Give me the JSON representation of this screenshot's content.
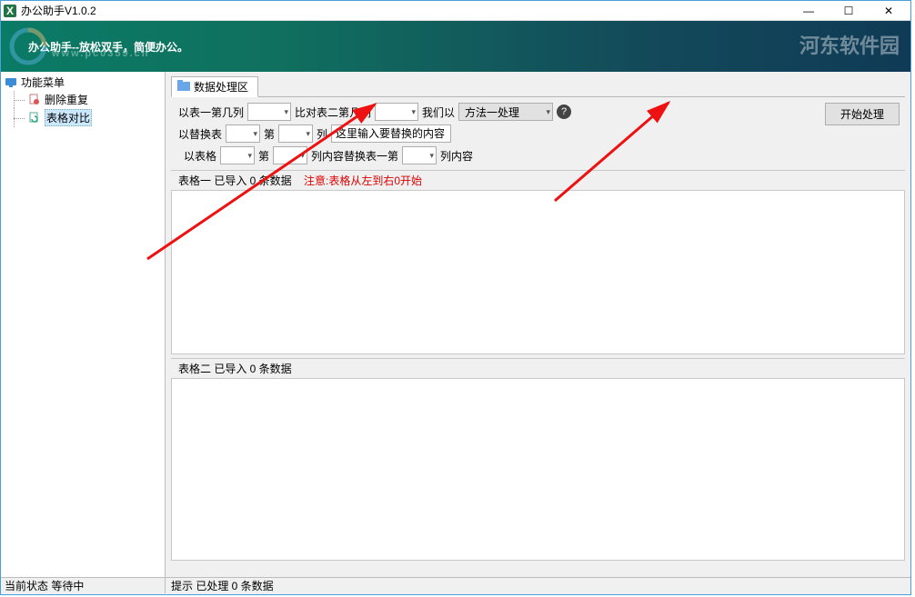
{
  "titlebar": {
    "title": "办公助手V1.0.2"
  },
  "banner": {
    "slogan": "办公助手--放松双手，简便办公。",
    "watermark": "河东软件园",
    "wmurl": "www.pc0359.cn"
  },
  "sidebar": {
    "root": "功能菜单",
    "items": [
      "删除重复",
      "表格对比"
    ]
  },
  "tab": {
    "label": "数据处理区"
  },
  "row1": {
    "l1": "以表一第几列",
    "l2": "比对表二第几列",
    "l3": "我们以",
    "method": "方法一处理"
  },
  "row2": {
    "l1": "以替换表",
    "l2": "第",
    "l3": "列",
    "placeholder": "这里输入要替换的内容"
  },
  "row3": {
    "l1": "以表格",
    "l2": "第",
    "l3": "列内容替换表一第",
    "l4": "列内容"
  },
  "startBtn": "开始处理",
  "panel1": {
    "header": "表格一   已导入  0  条数据",
    "warn": "注意:表格从左到右0开始"
  },
  "panel2": {
    "header": "表格二   已导入  0  条数据"
  },
  "status": {
    "left": "当前状态   等待中",
    "right": "提示  已处理  0  条数据"
  }
}
